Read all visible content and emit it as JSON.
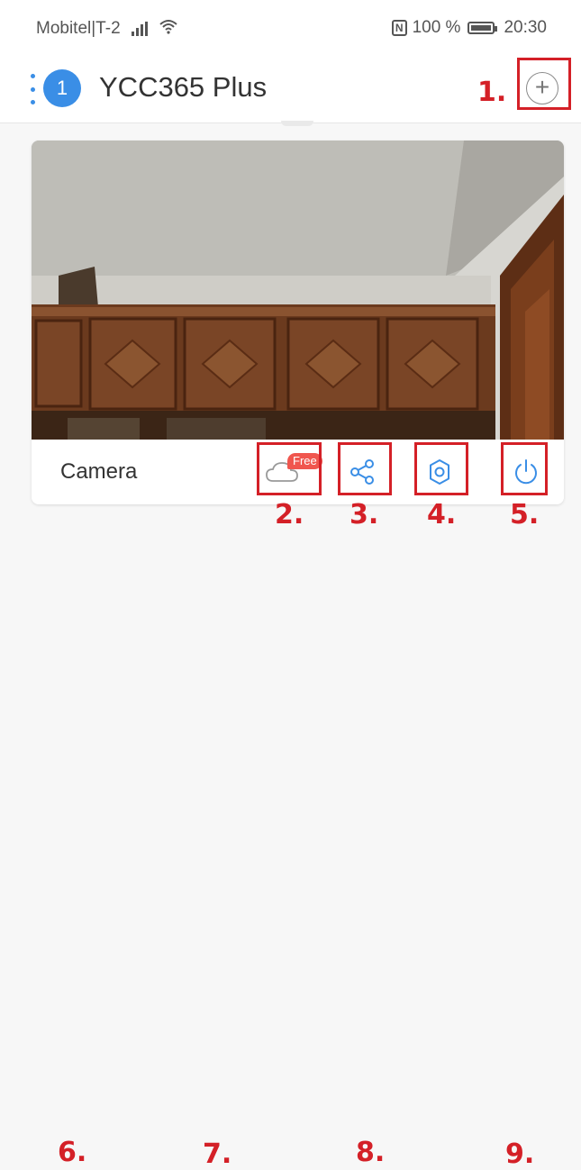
{
  "status_bar": {
    "carrier": "Mobitel|T-2",
    "battery_percent": "100 %",
    "battery_level": 1.0,
    "time": "20:30",
    "icons": [
      "signal-icon",
      "wifi-icon",
      "nfc-icon",
      "battery-icon"
    ]
  },
  "header": {
    "badge_count": "1",
    "app_title": "YCC365 Plus",
    "add_icon": "plus-icon"
  },
  "camera_card": {
    "name": "Camera",
    "cloud_badge": "Free",
    "actions": [
      "cloud-icon",
      "share-icon",
      "settings-icon",
      "power-icon"
    ],
    "accent_color": "#3a8ee6"
  },
  "annotations": {
    "n1": "1.",
    "n2": "2.",
    "n3": "3.",
    "n4": "4.",
    "n5": "5.",
    "n6": "6.",
    "n7": "7.",
    "n8": "8.",
    "n9": "9.",
    "color": "#d42027"
  }
}
